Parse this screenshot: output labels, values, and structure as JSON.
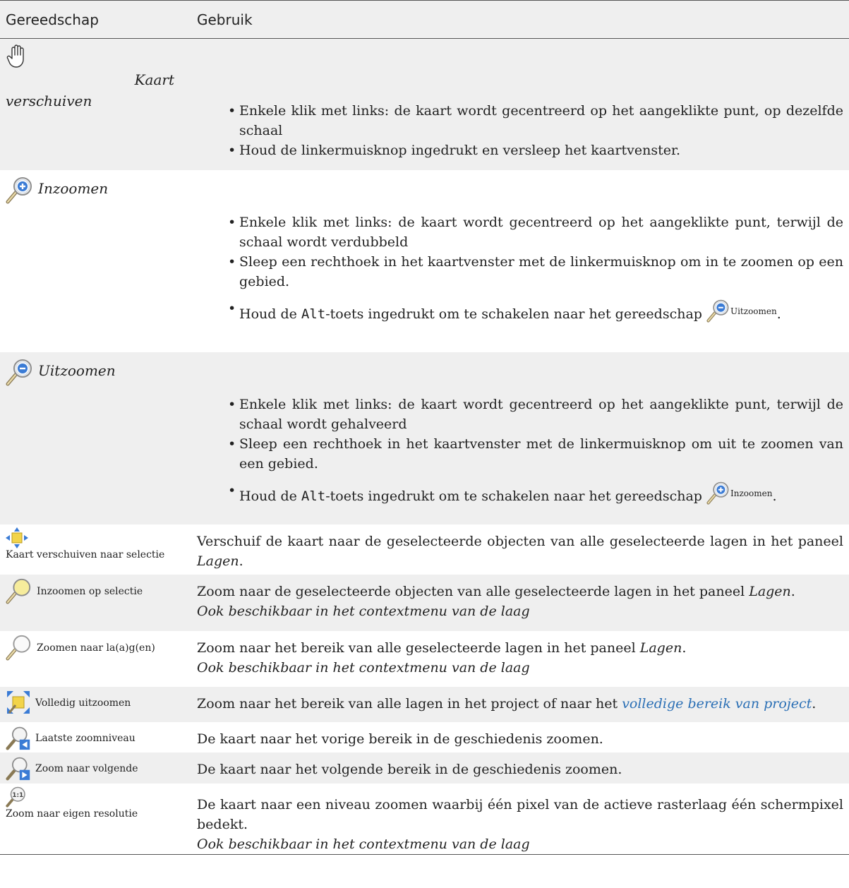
{
  "header": {
    "col_tool": "Gereedschap",
    "col_usage": "Gebruik"
  },
  "rows": [
    {
      "tool": "Kaart verschuiven",
      "tool_line1": "Kaart",
      "tool_line2": "verschuiven",
      "icon": "pan-hand-icon",
      "bullets": [
        "Enkele klik met links: de kaart wordt gecentreerd op het aangeklikte punt, op dezelfde schaal",
        "Houd de linkermuisknop ingedrukt en versleep het kaartvenster."
      ]
    },
    {
      "tool": "Inzoomen",
      "icon": "zoom-in-icon",
      "bullets": [
        "Enkele klik met links: de kaart wordt gecentreerd op het aangeklikte punt, terwijl de schaal wordt verdubbeld",
        "Sleep een rechthoek in het kaartvenster met de linkermuisknop om in te zoomen op een gebied."
      ],
      "alt_before": "Houd de ",
      "alt_key": "Alt",
      "alt_after": "-toets ingedrukt om te schakelen naar het gereedschap ",
      "alt_tool": "Uitzoomen",
      "alt_end": "."
    },
    {
      "tool": "Uitzoomen",
      "icon": "zoom-out-icon",
      "bullets": [
        "Enkele klik met links: de kaart wordt gecentreerd op het aangeklikte punt, terwijl de schaal wordt gehalveerd",
        "Sleep een rechthoek in het kaartvenster met de linkermuisknop om uit te zoomen van een gebied."
      ],
      "alt_before": "Houd de ",
      "alt_key": "Alt",
      "alt_after": "-toets ingedrukt om te schakelen naar het gereedschap ",
      "alt_tool": "Inzoomen",
      "alt_end": "."
    },
    {
      "tool": "Kaart verschuiven naar selectie",
      "icon": "pan-to-selection-icon",
      "text": "Verschuif de kaart naar de geselecteerde objecten van alle geselecteerde lagen in het paneel ",
      "em": "Lagen",
      "end": "."
    },
    {
      "tool": "Inzoomen op selectie",
      "icon": "zoom-to-selection-icon",
      "text": "Zoom naar de geselecteerde objecten van alle geselecteerde lagen in het paneel ",
      "em": "Lagen",
      "end": ".",
      "note": "Ook beschikbaar in het contextmenu van de laag"
    },
    {
      "tool": "Zoomen naar la(a)g(en)",
      "icon": "zoom-to-layer-icon",
      "text": "Zoom naar het bereik van alle geselecteerde lagen in het paneel ",
      "em": "Lagen",
      "end": ".",
      "note": "Ook beschikbaar in het contextmenu van de laag"
    },
    {
      "tool": "Volledig uitzoomen",
      "icon": "zoom-full-icon",
      "text": "Zoom naar het bereik van alle lagen in het project of naar het ",
      "link": "volledige bereik van project",
      "end": "."
    },
    {
      "tool": "Laatste zoomniveau",
      "icon": "zoom-last-icon",
      "text": "De kaart naar het vorige bereik in de geschiedenis zoomen."
    },
    {
      "tool": "Zoom naar volgende",
      "icon": "zoom-next-icon",
      "text": "De kaart naar het volgende bereik in de geschiedenis zoomen."
    },
    {
      "tool": "Zoom naar eigen resolutie",
      "icon": "zoom-actual-size-icon",
      "text": "De kaart naar een niveau zoomen waarbij één pixel van de actieve rasterlaag één schermpixel bedekt.",
      "note": "Ook beschikbaar in het contextmenu van de laag"
    }
  ]
}
